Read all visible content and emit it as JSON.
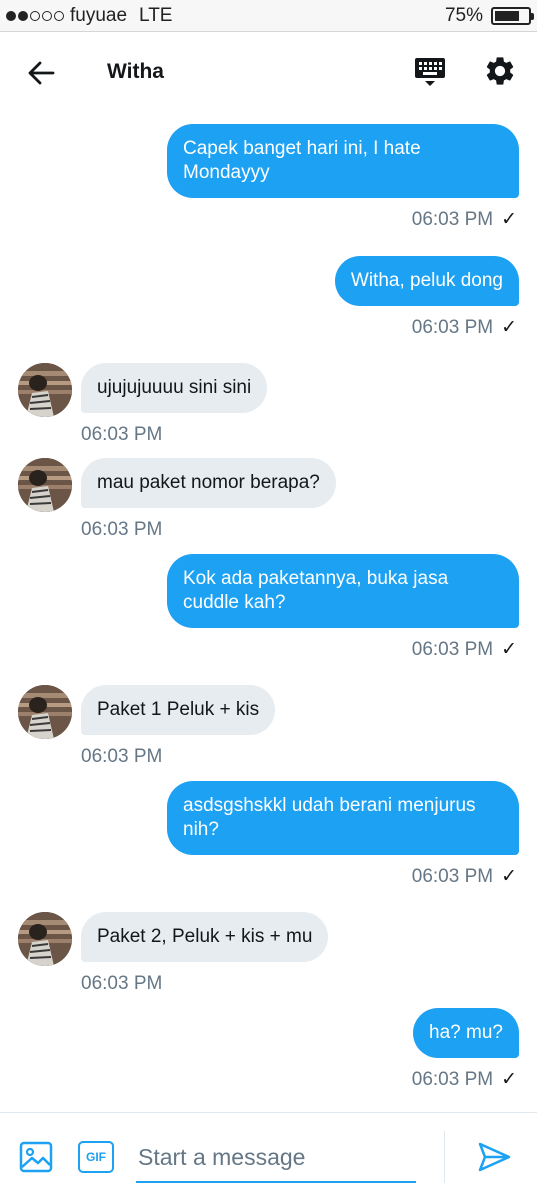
{
  "status_bar": {
    "carrier": "fuyuae",
    "network": "LTE",
    "battery_percent": "75%",
    "battery_level": 0.75,
    "signal_bars_filled": 2,
    "signal_bars_total": 5
  },
  "header": {
    "title": "Witha",
    "back_icon": "back-arrow-icon",
    "keyboard_icon": "keyboard-icon",
    "settings_icon": "gear-icon"
  },
  "messages": [
    {
      "direction": "sent",
      "text": "Capek banget hari ini, I hate Mondayyy",
      "time": "06:03 PM",
      "check": "✓"
    },
    {
      "direction": "sent",
      "text": "Witha, peluk dong",
      "time": "06:03 PM",
      "check": "✓"
    },
    {
      "direction": "received",
      "text": "ujujujuuuu sini sini",
      "time": "06:03 PM"
    },
    {
      "direction": "received",
      "text": "mau paket nomor berapa?",
      "time": "06:03 PM"
    },
    {
      "direction": "sent",
      "text": "Kok ada paketannya, buka jasa cuddle kah?",
      "time": "06:03 PM",
      "check": "✓"
    },
    {
      "direction": "received",
      "text": "Paket 1 Peluk + kis",
      "time": "06:03 PM"
    },
    {
      "direction": "sent",
      "text": "asdsgshskkl udah berani menjurus nih?",
      "time": "06:03 PM",
      "check": "✓"
    },
    {
      "direction": "received",
      "text": "Paket 2, Peluk + kis + mu",
      "time": "06:03 PM"
    },
    {
      "direction": "sent",
      "text": "ha? mu?",
      "time": "06:03 PM",
      "check": "✓"
    }
  ],
  "composer": {
    "placeholder": "Start a message",
    "gif_label": "GIF",
    "media_icon": "image-icon",
    "send_icon": "send-icon"
  },
  "colors": {
    "accent": "#1da1f2",
    "received_bubble": "#e6ecf0",
    "timestamp": "#657786"
  }
}
